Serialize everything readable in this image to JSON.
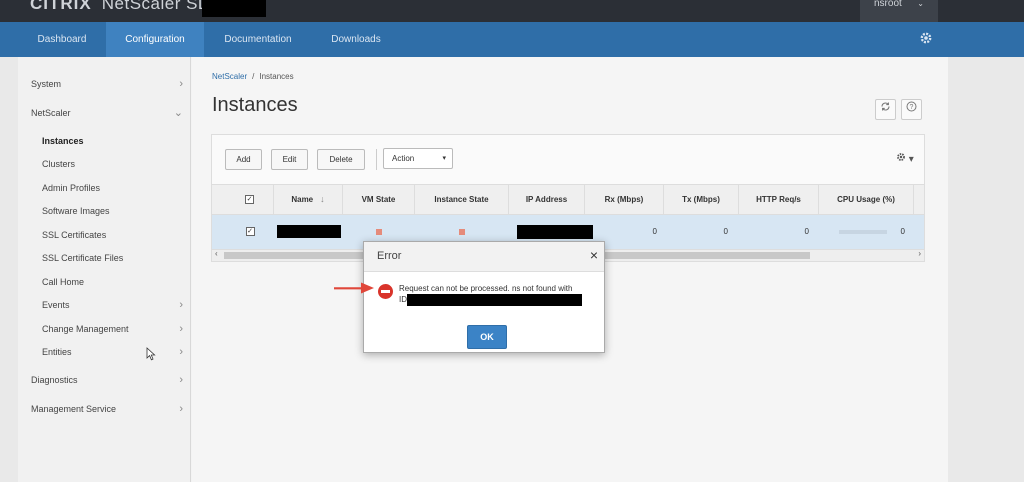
{
  "header": {
    "logo": "CITRIX",
    "product": "NetScaler SDX",
    "user": "nsroot",
    "user_chevron": "⌄"
  },
  "nav": {
    "tabs": [
      {
        "label": "Dashboard"
      },
      {
        "label": "Configuration",
        "active": true
      },
      {
        "label": "Documentation"
      },
      {
        "label": "Downloads"
      }
    ],
    "settings_icon": "gear-icon"
  },
  "sidebar": {
    "items": [
      {
        "label": "System",
        "chevron": "›"
      },
      {
        "label": "NetScaler",
        "chevron": "⌄"
      },
      {
        "label": "Instances",
        "active": true
      },
      {
        "label": "Clusters"
      },
      {
        "label": "Admin Profiles"
      },
      {
        "label": "Software Images"
      },
      {
        "label": "SSL Certificates"
      },
      {
        "label": "SSL Certificate Files"
      },
      {
        "label": "Call Home"
      },
      {
        "label": "Events",
        "chevron": "›"
      },
      {
        "label": "Change Management",
        "chevron": "›"
      },
      {
        "label": "Entities",
        "chevron": "›"
      },
      {
        "label": "Diagnostics",
        "chevron": "›"
      },
      {
        "label": "Management Service",
        "chevron": "›"
      }
    ]
  },
  "breadcrumb": {
    "root": "NetScaler",
    "separator": "/",
    "current": "Instances"
  },
  "page": {
    "title": "Instances"
  },
  "toolbar": {
    "add": "Add",
    "edit": "Edit",
    "delete": "Delete",
    "action": "Action",
    "action_caret": "▾",
    "settings_caret": "▾"
  },
  "table": {
    "columns": [
      "Name",
      "VM State",
      "Instance State",
      "IP Address",
      "Rx (Mbps)",
      "Tx (Mbps)",
      "HTTP Req/s",
      "CPU Usage (%)"
    ],
    "rows": [
      {
        "rx": "0",
        "tx": "0",
        "http": "0",
        "cpu": "0",
        "vm_state_color": "#e58b7a"
      }
    ],
    "scroll_left": "‹",
    "scroll_right": "›"
  },
  "dialog": {
    "title": "Error",
    "close": "×",
    "message_line1": "Request can not be processed. ns not found with",
    "message_line2": "ID",
    "ok": "OK"
  },
  "colors": {
    "topbar": "#2b2f36",
    "navbar": "#2f6ea8",
    "nav_active": "#3f82c0",
    "error_red": "#d9342b",
    "ok_button": "#3b83c6",
    "annotation_arrow": "#e0473a"
  }
}
